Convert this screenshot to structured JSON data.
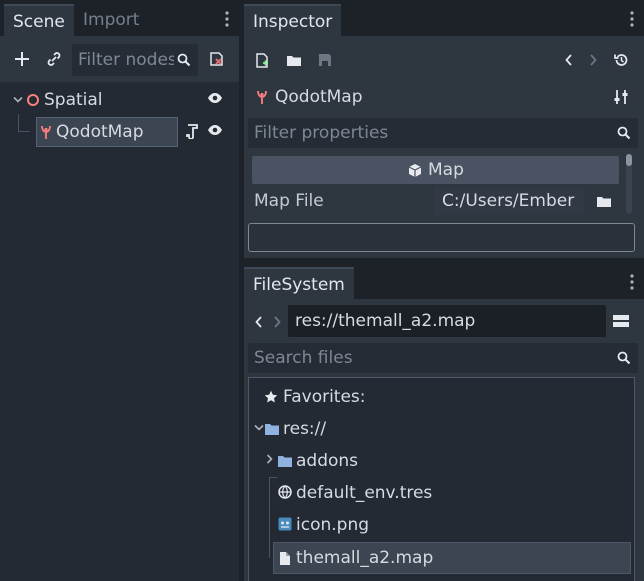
{
  "scene_dock": {
    "tabs": [
      {
        "label": "Scene"
      },
      {
        "label": "Import"
      }
    ],
    "filter_placeholder": "Filter nodes",
    "tree": [
      {
        "label": "Spatial"
      },
      {
        "label": "QodotMap"
      }
    ]
  },
  "inspector": {
    "tab_label": "Inspector",
    "object_name": "QodotMap",
    "filter_placeholder": "Filter properties",
    "section_label": "Map",
    "property_label": "Map File",
    "property_value": "C:/Users/Ember"
  },
  "filesystem": {
    "tab_label": "FileSystem",
    "path_value": "res://themall_a2.map",
    "search_placeholder": "Search files",
    "items": [
      {
        "label": "Favorites:"
      },
      {
        "label": "res://"
      },
      {
        "label": "addons"
      },
      {
        "label": "default_env.tres"
      },
      {
        "label": "icon.png"
      },
      {
        "label": "themall_a2.map"
      }
    ]
  },
  "colors": {
    "accent": "#e06c75",
    "folder": "#8fb2e0",
    "background": "#1d2229",
    "panel": "#232a33"
  }
}
